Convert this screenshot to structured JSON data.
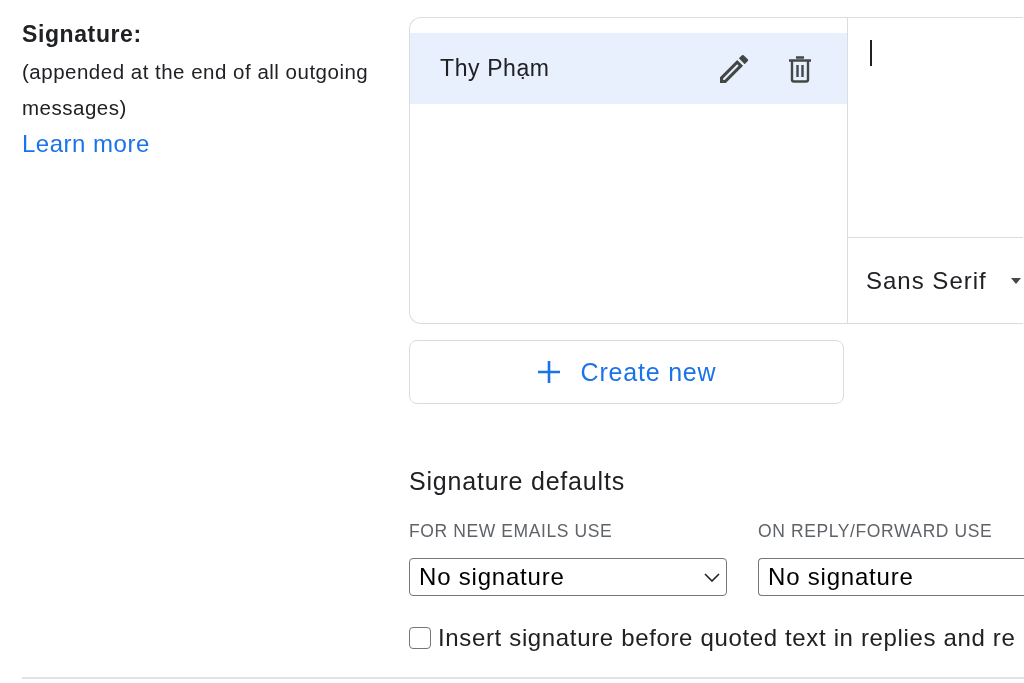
{
  "setting": {
    "label": "Signature:",
    "description": "(appended at the end of all outgoing messages)",
    "link": "Learn more"
  },
  "signature_list": {
    "items": [
      {
        "name": "Thy Phạm",
        "selected": true
      }
    ]
  },
  "editor": {
    "font": "Sans Serif"
  },
  "create_button": {
    "label": "Create new"
  },
  "defaults": {
    "title": "Signature defaults",
    "fields": [
      {
        "label": "FOR NEW EMAILS USE",
        "value": "No signature",
        "clipped": false
      },
      {
        "label": "ON REPLY/FORWARD USE",
        "value": "No signature",
        "clipped": true
      }
    ]
  },
  "checkbox": {
    "label": "Insert signature before quoted text in replies and re",
    "checked": false
  }
}
